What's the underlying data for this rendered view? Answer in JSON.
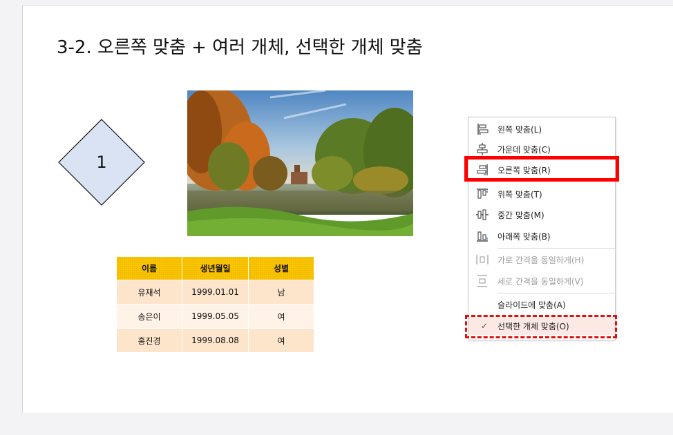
{
  "slide": {
    "title": "3-2. 오른쪽 맞춤 + 여러 개체, 선택한 개체 맞춤",
    "shape_label": "1"
  },
  "table": {
    "headers": [
      "이름",
      "생년월일",
      "성별"
    ],
    "rows": [
      [
        "유재석",
        "1999.01.01",
        "남"
      ],
      [
        "송은이",
        "1999.05.05",
        "여"
      ],
      [
        "홍진경",
        "1999.08.08",
        "여"
      ]
    ],
    "colors": {
      "header": "#f9c400",
      "row_dark": "#fde5cc",
      "row_light": "#fff2e6"
    }
  },
  "menu": {
    "items": [
      {
        "label": "왼쪽 맞춤(L)",
        "icon": "align-left-icon",
        "enabled": true
      },
      {
        "label": "가운데 맞춤(C)",
        "icon": "align-center-icon",
        "enabled": true
      },
      {
        "label": "오른쪽 맞춤(R)",
        "icon": "align-right-icon",
        "enabled": true
      },
      {
        "label": "위쪽 맞춤(T)",
        "icon": "align-top-icon",
        "enabled": true
      },
      {
        "label": "중간 맞춤(M)",
        "icon": "align-middle-icon",
        "enabled": true
      },
      {
        "label": "아래쪽 맞춤(B)",
        "icon": "align-bottom-icon",
        "enabled": true
      },
      {
        "label": "가로 간격을 동일하게(H)",
        "icon": "distribute-horizontal-icon",
        "enabled": false
      },
      {
        "label": "세로 간격을 동일하게(V)",
        "icon": "distribute-vertical-icon",
        "enabled": false
      },
      {
        "label": "슬라이드에 맞춤(A)",
        "enabled": true
      },
      {
        "label": "선택한 개체 맞춤(O)",
        "enabled": true,
        "checked": true,
        "check_mark": "✓"
      }
    ],
    "highlight_color": "#ff0000"
  }
}
